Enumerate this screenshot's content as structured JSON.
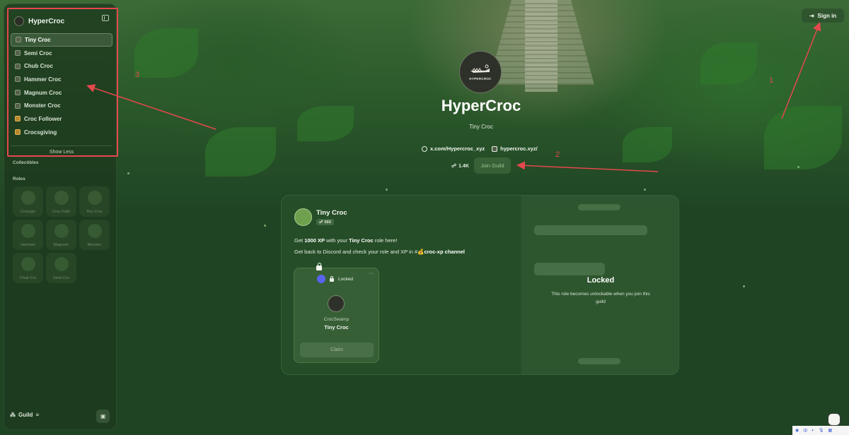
{
  "sidebar": {
    "title": "HyperCroc",
    "items": [
      {
        "label": "Tiny Croc",
        "active": true,
        "icon": "role-icon"
      },
      {
        "label": "Semi Croc",
        "active": false,
        "icon": "role-icon"
      },
      {
        "label": "Chub Croc",
        "active": false,
        "icon": "role-icon"
      },
      {
        "label": "Hammer Croc",
        "active": false,
        "icon": "role-icon"
      },
      {
        "label": "Magnum Croc",
        "active": false,
        "icon": "role-icon"
      },
      {
        "label": "Monster Croc",
        "active": false,
        "icon": "role-icon"
      },
      {
        "label": "Croc Follower",
        "active": false,
        "icon": "gold-role-icon"
      },
      {
        "label": "Crocsgiving",
        "active": false,
        "icon": "gold-role-icon"
      }
    ],
    "show_less": "Show Less",
    "collectibles_heading": "Collectibles",
    "roles_heading": "Roles",
    "roles": [
      {
        "label": "Crocsgiv"
      },
      {
        "label": "Croc Follo"
      },
      {
        "label": "Tiny Croc"
      },
      {
        "label": "Hammer"
      },
      {
        "label": "Magnum"
      },
      {
        "label": "Monster"
      },
      {
        "label": "Chub Cro"
      },
      {
        "label": "Semi Cro"
      }
    ],
    "footer_label": "Guild"
  },
  "header": {
    "signin_label": "Sign in"
  },
  "guild": {
    "logo_text": "HYPERCROC",
    "name": "HyperCroc",
    "subtitle": "Tiny Croc",
    "links": [
      {
        "label": "x.com/Hypercroc_xyz",
        "icon": "globe-icon"
      },
      {
        "label": "hypercroc.xyz/",
        "icon": "site-icon"
      }
    ],
    "members": "1.4K",
    "join_label": "Join Guild"
  },
  "role_card": {
    "title": "Tiny Croc",
    "count": "593",
    "desc_1_pre": "Get ",
    "desc_1_xp": "1000 XP",
    "desc_1_mid": " with your ",
    "desc_1_role": "Tiny Croc",
    "desc_1_post": " role here!",
    "desc_2_pre": "Get back to Discord and check your role and XP in #",
    "desc_2_channel": "croc-xp channel",
    "reward": {
      "status": "Locked",
      "more": "···",
      "platform": "CrocSwamp",
      "name": "Tiny Croc",
      "claim_label": "Claim"
    },
    "locked_title": "Locked",
    "locked_text": "This role becomes unlockable when you join this guild"
  },
  "annotations": {
    "n1": "1",
    "n2": "2",
    "n3": "3",
    "color": "#e5484d"
  }
}
